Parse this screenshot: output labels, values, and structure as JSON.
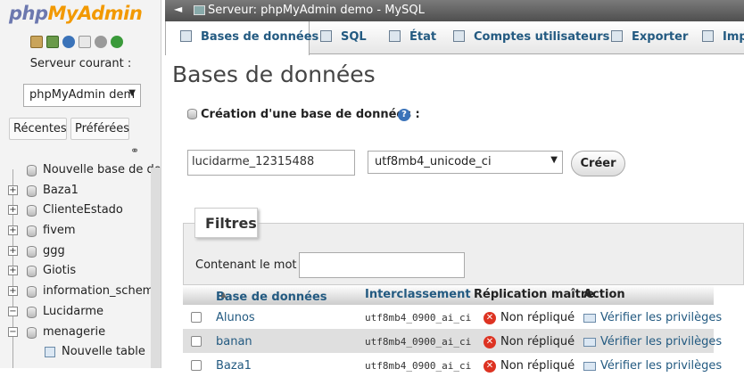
{
  "nav": {
    "logo_php": "php",
    "logo_my": "My",
    "logo_admin": "Admin",
    "server_label": "Serveur courant :",
    "server_selected": "phpMyAdmin dem",
    "tab_recent": "Récentes",
    "tab_favorites": "Préférées",
    "tree": [
      {
        "label": "Nouvelle base de do",
        "expander": "",
        "kind": "new"
      },
      {
        "label": "Baza1",
        "expander": "+",
        "kind": "db"
      },
      {
        "label": "ClienteEstado",
        "expander": "+",
        "kind": "db"
      },
      {
        "label": "fivem",
        "expander": "+",
        "kind": "db"
      },
      {
        "label": "ggg",
        "expander": "+",
        "kind": "db"
      },
      {
        "label": "Giotis",
        "expander": "+",
        "kind": "db"
      },
      {
        "label": "information_schema",
        "expander": "+",
        "kind": "db"
      },
      {
        "label": "Lucidarme",
        "expander": "−",
        "kind": "db"
      },
      {
        "label": "menagerie",
        "expander": "−",
        "kind": "db"
      },
      {
        "label": "Nouvelle table",
        "expander": "",
        "kind": "table"
      }
    ]
  },
  "topbar": {
    "back_glyph": "◄",
    "title": "Serveur: phpMyAdmin demo - MySQL"
  },
  "tabs": [
    {
      "label": "Bases de données",
      "active": true
    },
    {
      "label": "SQL",
      "active": false
    },
    {
      "label": "État",
      "active": false
    },
    {
      "label": "Comptes utilisateurs",
      "active": false
    },
    {
      "label": "Exporter",
      "active": false
    },
    {
      "label": "Imp",
      "active": false
    }
  ],
  "main": {
    "title": "Bases de données",
    "create_label": "Création d'une base de données :",
    "db_name_value": "lucidarme_12315488",
    "collation_selected": "utf8mb4_unicode_ci",
    "create_button": "Créer",
    "filters_title": "Filtres",
    "filter_label": "Contenant le mot :",
    "filter_value": ""
  },
  "table": {
    "headers": {
      "database": "Base de données",
      "collation": "Interclassement",
      "replication": "Réplication maître",
      "action": "Action"
    },
    "rows": [
      {
        "name": "Alunos",
        "collation": "utf8mb4_0900_ai_ci",
        "replication": "Non répliqué",
        "action": "Vérifier les privilèges"
      },
      {
        "name": "banan",
        "collation": "utf8mb4_0900_ai_ci",
        "replication": "Non répliqué",
        "action": "Vérifier les privilèges"
      },
      {
        "name": "Baza1",
        "collation": "utf8mb4_0900_ai_ci",
        "replication": "Non répliqué",
        "action": "Vérifier les privilèges"
      }
    ]
  },
  "colors": {
    "link": "#235a81",
    "topbar": "#5a5a5a",
    "error": "#dd3322"
  }
}
